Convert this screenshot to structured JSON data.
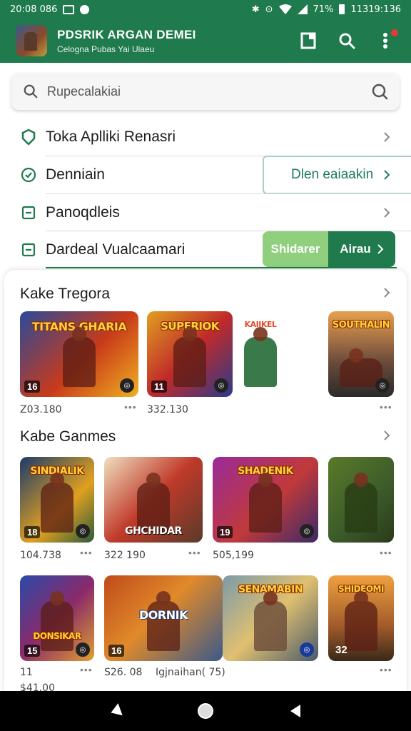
{
  "status_bar": {
    "time_left": "20:08 086",
    "time_right": "11319:136",
    "battery": "71%"
  },
  "app_bar": {
    "title": "PDSRIK ARGAN DEMEI",
    "subtitle": "Celogna Pubas Yai Ulaeu"
  },
  "search": {
    "placeholder": "Rupecalakiai"
  },
  "menu": {
    "items": [
      {
        "label": "Toka Aplliki Renasri",
        "icon": "shield-icon"
      },
      {
        "label": "Denniain",
        "icon": "clock-icon",
        "action_label": "Dlen eaiaakin"
      },
      {
        "label": "Panoqdleis",
        "icon": "square-icon"
      },
      {
        "label": "Dardeal Vualcaamari",
        "icon": "square-icon",
        "btn_left": "Shidarer",
        "btn_right": "Airau"
      }
    ]
  },
  "sections": [
    {
      "title": "Kake Tregora",
      "tiles": [
        {
          "title": "TITANS GHARIA",
          "num": "16",
          "meta": "Z03.180"
        },
        {
          "title": "SUPERIOK",
          "num": "11",
          "meta": "332.130"
        },
        {
          "title": "KAIIKEL",
          "num": "",
          "meta": ""
        },
        {
          "title": "SOUTHALIN",
          "num": "",
          "meta": ""
        }
      ]
    },
    {
      "title": "Kabe Ganmes",
      "tiles": [
        {
          "title": "SINDIALIK",
          "num": "18",
          "meta": "104.738"
        },
        {
          "title": "GHCHIDAR",
          "num": "",
          "meta": "322 190"
        },
        {
          "title": "SHADENIK",
          "num": "19",
          "meta": "505,199"
        },
        {
          "title": "",
          "num": "",
          "meta": ""
        }
      ]
    },
    {
      "title": "",
      "tiles": [
        {
          "title": "DONSIKAR",
          "num": "15",
          "meta": "11"
        },
        {
          "title": "DORNIK",
          "num": "16",
          "meta": "S26. 08"
        },
        {
          "title": "SENAMABIN",
          "num": "",
          "meta": "Igjnaihan( 75)"
        },
        {
          "title": "SHIDEOMI",
          "num": "32",
          "meta": ""
        }
      ]
    }
  ],
  "bottom_peek": "$41.00",
  "colors": {
    "primary": "#1f7a4d",
    "accent_light": "#8fcf7d"
  }
}
